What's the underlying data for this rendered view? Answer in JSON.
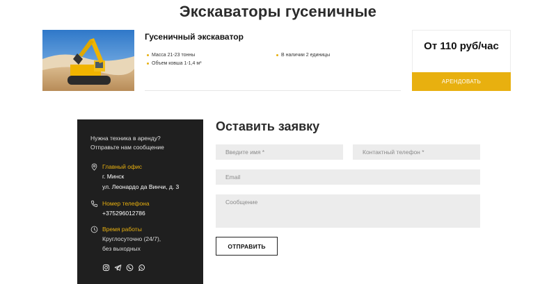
{
  "page": {
    "title": "Экскаваторы гусеничные"
  },
  "product": {
    "image_alt": "excavator-photo",
    "name": "Гусеничный экскаватор",
    "specs": {
      "mass": "Масса 21-23 тонны",
      "bucket": "Объем ковша 1-1,4 м³",
      "availability": "В наличии 2 единицы"
    },
    "price": "От 110 руб/час",
    "rent_button": "АРЕНДОВАТЬ"
  },
  "contact": {
    "intro_line1": "Нужна техника в аренду?",
    "intro_line2": "Отправьте нам сообщение",
    "office": {
      "title": "Главный офис",
      "city": "г. Минск",
      "address": "ул. Леонардо да Винчи, д. 3"
    },
    "phone": {
      "title": "Номер телефона",
      "number": "+375296012786"
    },
    "hours": {
      "title": "Время работы",
      "line1": "Круглосуточно (24/7),",
      "line2": "без выходных"
    },
    "social_icons": [
      "instagram-icon",
      "telegram-icon",
      "viber-icon",
      "whatsapp-icon"
    ]
  },
  "form": {
    "title": "Оставить заявку",
    "name_placeholder": "Введите имя *",
    "phone_placeholder": "Контактный телефон *",
    "email_placeholder": "Email",
    "message_placeholder": "Сообщение",
    "submit": "ОТПРАВИТЬ"
  },
  "colors": {
    "accent": "#e8b00f",
    "dark_panel": "#1f1f1f",
    "field_bg": "#ececec"
  }
}
